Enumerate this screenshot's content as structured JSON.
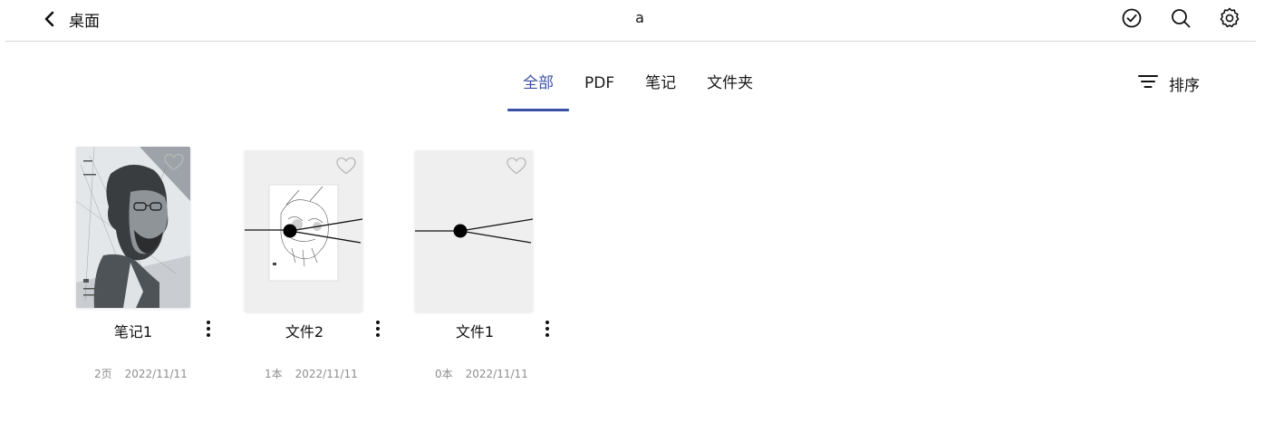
{
  "header": {
    "back_label": "桌面",
    "title": "a",
    "icons": [
      "check-circle-icon",
      "search-icon",
      "gear-icon"
    ]
  },
  "tabs": [
    {
      "label": "全部",
      "active": true
    },
    {
      "label": "PDF",
      "active": false
    },
    {
      "label": "笔记",
      "active": false
    },
    {
      "label": "文件夹",
      "active": false
    }
  ],
  "sort": {
    "label": "排序",
    "icon": "sort-lines-icon"
  },
  "accent_color": "#3c52a5",
  "items": [
    {
      "name": "笔记1",
      "count": "2页",
      "date": "2022/11/11",
      "cover": "portrait-sketch",
      "favorite_icon": "heart-outline-icon"
    },
    {
      "name": "文件2",
      "count": "1本",
      "date": "2022/11/11",
      "cover": "skull-sketch",
      "favorite_icon": "heart-outline-icon"
    },
    {
      "name": "文件1",
      "count": "0本",
      "date": "2022/11/11",
      "cover": "blank",
      "favorite_icon": "heart-outline-icon"
    }
  ]
}
